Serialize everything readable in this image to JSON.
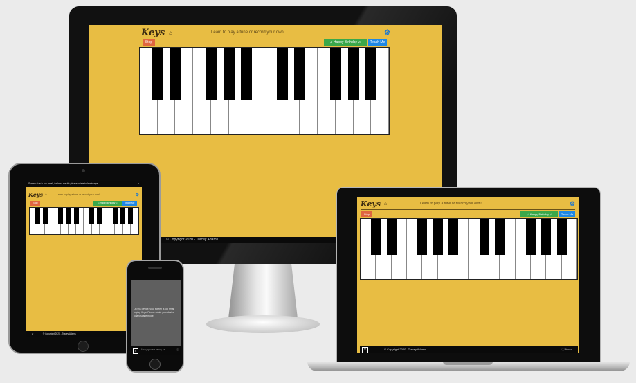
{
  "app": {
    "logo": "Keys",
    "home_icon": "home-icon",
    "tagline": "Learn to play a tune or record your own!",
    "settings_icon": "cogs-icon",
    "stop_label": "Stop",
    "song_label": "♫ Happy Birthday ♫",
    "teach_label": "Teach Me",
    "footer_text": "© Copyright 2020 - Tracey Adams",
    "about_label": "About",
    "warning_text": "Screen size is too small, for best results please rotate to landscape",
    "close_label": "x",
    "phone_message": "On this device, your screen is too small to play Keys. Please rotate your device to landscape mode."
  },
  "piano": {
    "white_keys": 14,
    "black_key_after": [
      0,
      1,
      3,
      4,
      5,
      7,
      8,
      10,
      11,
      12
    ]
  }
}
